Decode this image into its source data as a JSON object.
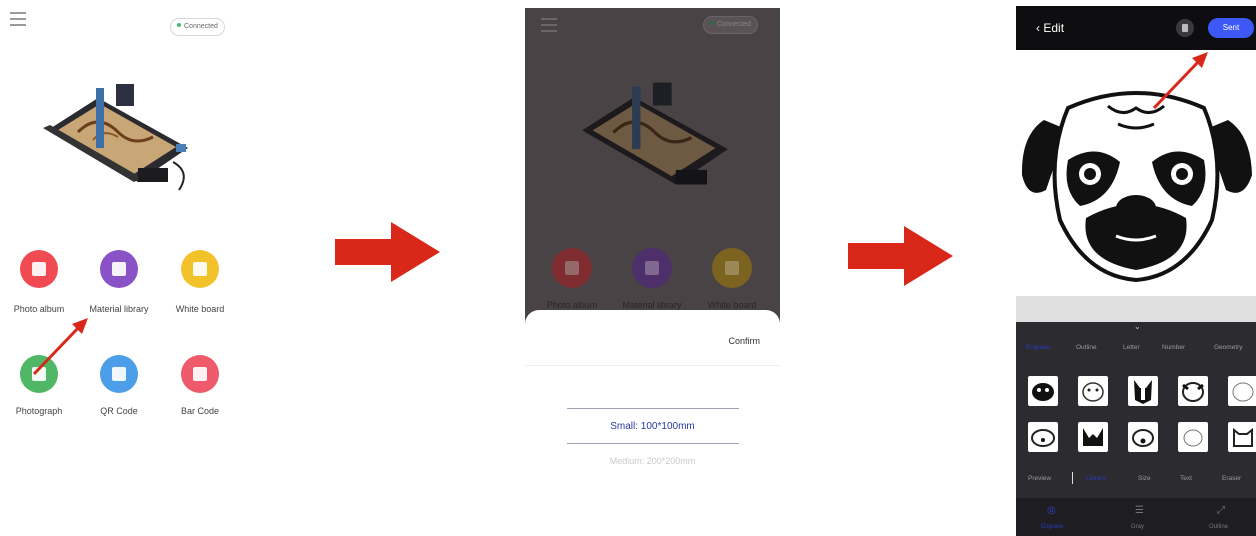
{
  "colors": {
    "arrow_red": "#d9281a",
    "connected_dot": "#3cc26b",
    "accent_blue": "#3d58f5",
    "icon_photo": "#f04b53",
    "icon_material": "#8a52c7",
    "icon_whiteboard": "#f2c22a",
    "icon_photograph": "#4fb765",
    "icon_qr": "#4d9ee8",
    "icon_barcode": "#ef5a6b"
  },
  "screen1": {
    "status": "Connected",
    "features": [
      {
        "label": "Photo album",
        "icon": "photo-icon"
      },
      {
        "label": "Material library",
        "icon": "material-library-icon"
      },
      {
        "label": "White board",
        "icon": "whiteboard-icon"
      },
      {
        "label": "Photograph",
        "icon": "camera-icon"
      },
      {
        "label": "QR Code",
        "icon": "qr-code-icon"
      },
      {
        "label": "Bar Code",
        "icon": "barcode-icon"
      }
    ]
  },
  "screen2": {
    "status": "Connected",
    "features": [
      "Photo album",
      "Material library",
      "White board"
    ],
    "confirm": "Confirm",
    "options": [
      "Small: 100*100mm",
      "Medium: 200*200mm"
    ]
  },
  "screen3": {
    "title": "Edit",
    "send_button": "Sent",
    "category_tabs": [
      "Engrave",
      "Outline",
      "Letter",
      "Number",
      "Geometry"
    ],
    "tools": [
      "Preview",
      "Library",
      "Size",
      "Text",
      "Eraser"
    ],
    "bottom_nav": [
      "Engrave",
      "Gray",
      "Outline"
    ]
  }
}
